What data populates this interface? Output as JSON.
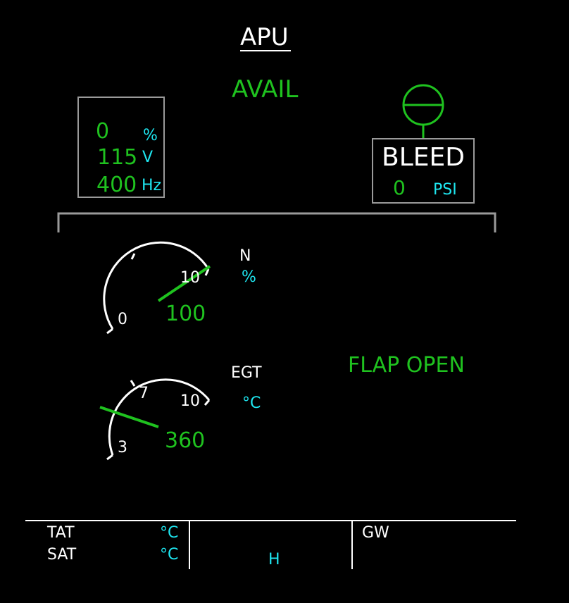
{
  "page": {
    "title": "APU",
    "status": "AVAIL"
  },
  "generator": {
    "load_value": "0",
    "load_unit": "%",
    "voltage_value": "115",
    "voltage_unit": "V",
    "frequency_value": "400",
    "frequency_unit": "Hz"
  },
  "bleed": {
    "label": "BLEED",
    "pressure_value": "0",
    "pressure_unit": "PSI",
    "valve_state": "open"
  },
  "n_gauge": {
    "label": "N",
    "unit": "%",
    "tick_min": "0",
    "tick_max": "10",
    "value": "100"
  },
  "egt_gauge": {
    "label": "EGT",
    "unit": "°C",
    "tick_low": "3",
    "tick_mid": "7",
    "tick_max": "10",
    "value": "360"
  },
  "flap_status": "FLAP OPEN",
  "bottom": {
    "tat_label": "TAT",
    "tat_unit": "°C",
    "sat_label": "SAT",
    "sat_unit": "°C",
    "time_label": "H",
    "gw_label": "GW"
  },
  "colors": {
    "green": "#1fc21f",
    "cyan": "#1ee6f0",
    "white": "#ffffff",
    "grey": "#9a9a9a"
  }
}
